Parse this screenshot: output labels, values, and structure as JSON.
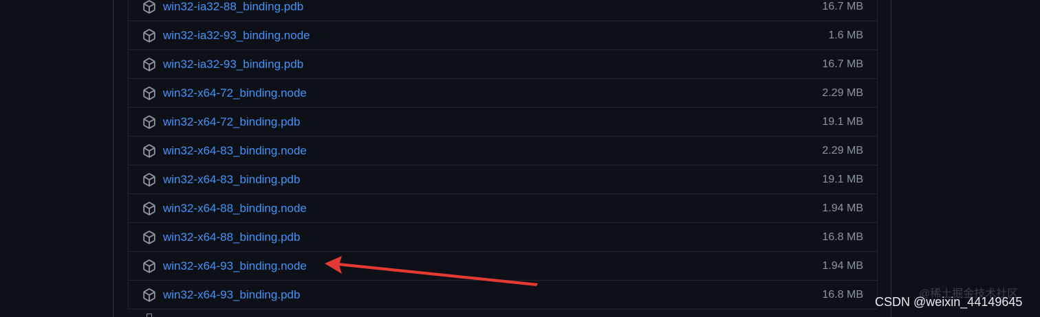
{
  "assets": [
    {
      "name": "win32-ia32-88_binding.pdb",
      "size": "16.7 MB"
    },
    {
      "name": "win32-ia32-93_binding.node",
      "size": "1.6 MB"
    },
    {
      "name": "win32-ia32-93_binding.pdb",
      "size": "16.7 MB"
    },
    {
      "name": "win32-x64-72_binding.node",
      "size": "2.29 MB"
    },
    {
      "name": "win32-x64-72_binding.pdb",
      "size": "19.1 MB"
    },
    {
      "name": "win32-x64-83_binding.node",
      "size": "2.29 MB"
    },
    {
      "name": "win32-x64-83_binding.pdb",
      "size": "19.1 MB"
    },
    {
      "name": "win32-x64-88_binding.node",
      "size": "1.94 MB"
    },
    {
      "name": "win32-x64-88_binding.pdb",
      "size": "16.8 MB"
    },
    {
      "name": "win32-x64-93_binding.node",
      "size": "1.94 MB"
    },
    {
      "name": "win32-x64-93_binding.pdb",
      "size": "16.8 MB"
    }
  ],
  "icons": {
    "asset": "package-icon"
  },
  "annotation": {
    "arrow_color": "#e53935",
    "points_to": "win32-x64-93_binding.node"
  },
  "watermark": {
    "text": "CSDN @weixin_44149645",
    "background_text": "@稀土掘金技术社区"
  },
  "colors": {
    "background": "#0d1117",
    "link": "#4493f8",
    "muted": "#8b949e",
    "border": "#21262d"
  }
}
